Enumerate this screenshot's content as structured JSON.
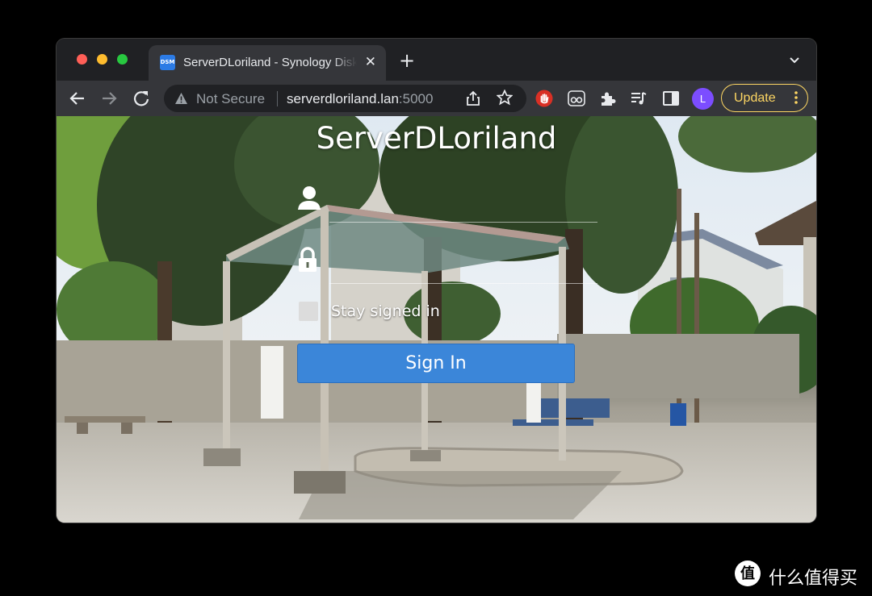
{
  "browser": {
    "tab": {
      "favicon_text": "DSM",
      "title": "ServerDLoriland - Synology DiskStation",
      "close_glyph": "✕"
    },
    "new_tab_glyph": "+",
    "omnibox": {
      "security_label": "Not Secure",
      "url_host": "serverdloriland.lan",
      "url_port": ":5000"
    },
    "extensions": [
      "stop-hand-icon",
      "reader-icon",
      "puzzle-icon",
      "media-queue-icon",
      "side-panel-icon"
    ],
    "profile_initial": "L",
    "update_label": "Update",
    "colors": {
      "update_accent": "#fdd663",
      "profile": "#7c4dff"
    }
  },
  "login": {
    "hostname": "ServerDLoriland",
    "username_placeholder": "",
    "password_placeholder": "",
    "stay_signed_in_label": "Stay signed in",
    "stay_signed_in_checked": false,
    "sign_in_label": "Sign In",
    "colors": {
      "sign_in_button": "#3b86d9"
    }
  },
  "watermark": {
    "logo_glyph": "值",
    "text": "什么值得买"
  }
}
